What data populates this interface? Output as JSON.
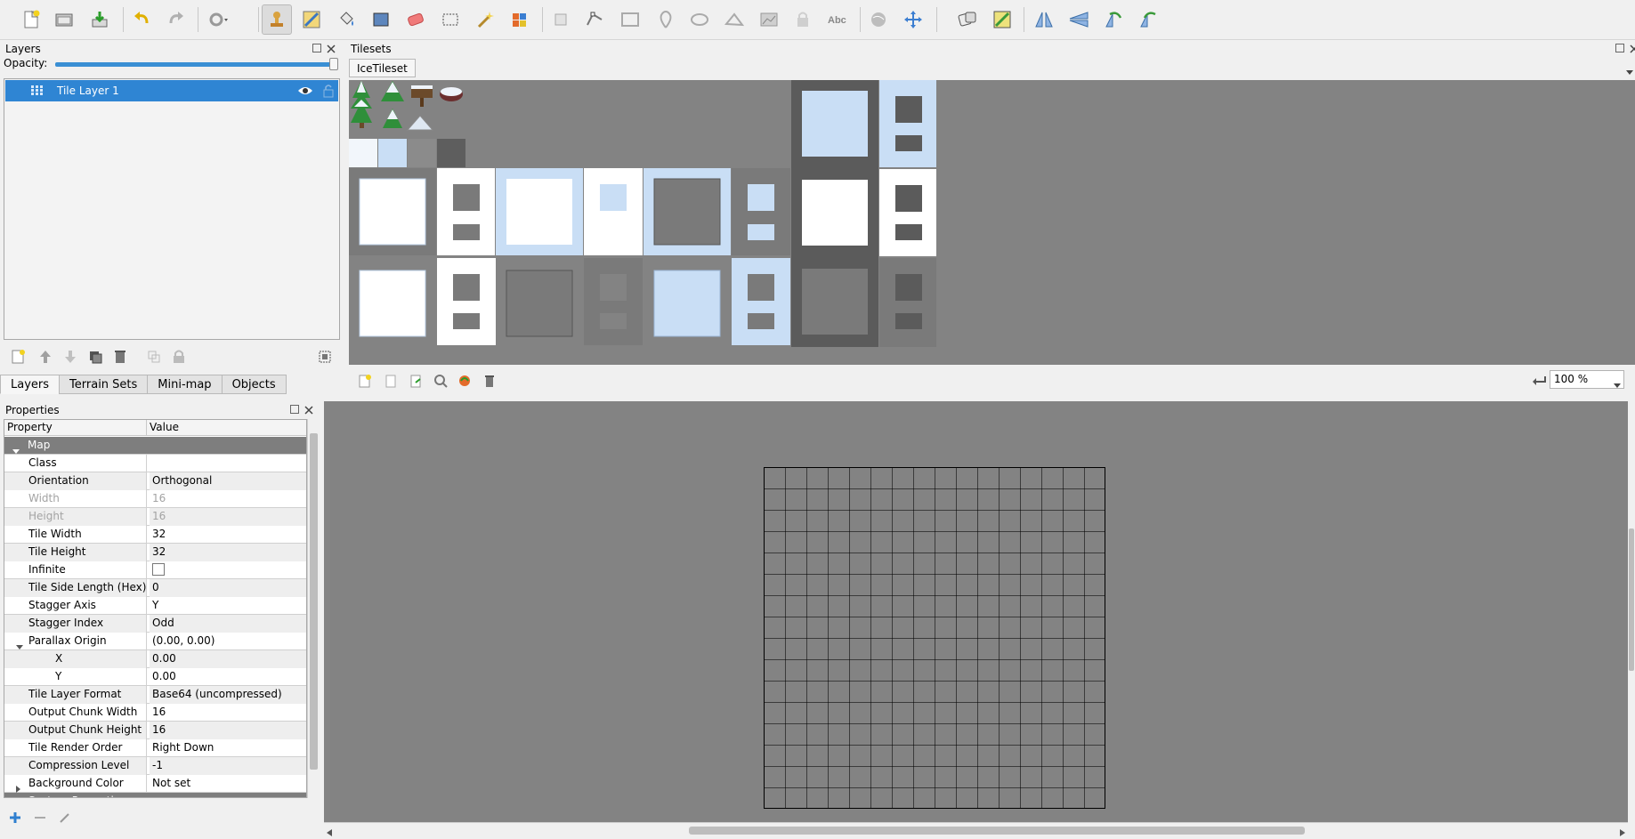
{
  "toolbar": {
    "icons": [
      "new-map-icon",
      "open-icon",
      "save-icon",
      "undo-icon",
      "redo-icon",
      "commands-icon",
      "stamp-brush-icon",
      "terrain-brush-icon",
      "bucket-fill-icon",
      "shape-fill-icon",
      "eraser-icon",
      "rect-select-icon",
      "magic-wand-icon",
      "select-same-tile-icon",
      "select-objects-icon",
      "edit-polygons-icon",
      "insert-rectangle-icon",
      "insert-point-icon",
      "insert-ellipse-icon",
      "insert-polygon-icon",
      "insert-tile-icon",
      "insert-template-icon",
      "insert-text-icon",
      "world-tool-icon",
      "move-icon",
      "random-mode-icon",
      "wang-fill-icon",
      "flip-horizontal-icon",
      "flip-vertical-icon",
      "rotate-left-icon",
      "rotate-right-icon"
    ]
  },
  "layers": {
    "title": "Layers",
    "opacity_label": "Opacity:",
    "opacity": 1.0,
    "items": [
      {
        "name": "Tile Layer 1",
        "visible": true
      }
    ]
  },
  "dock_tabs": [
    "Layers",
    "Terrain Sets",
    "Mini-map",
    "Objects"
  ],
  "properties": {
    "title": "Properties",
    "header": {
      "property": "Property",
      "value": "Value"
    },
    "rows": [
      {
        "name": "Map",
        "value": "",
        "kind": "group"
      },
      {
        "name": "Class",
        "value": ""
      },
      {
        "name": "Orientation",
        "value": "Orthogonal"
      },
      {
        "name": "Width",
        "value": "16",
        "kind": "dim"
      },
      {
        "name": "Height",
        "value": "16",
        "kind": "dim"
      },
      {
        "name": "Tile Width",
        "value": "32"
      },
      {
        "name": "Tile Height",
        "value": "32"
      },
      {
        "name": "Infinite",
        "value": "",
        "kind": "checkbox"
      },
      {
        "name": "Tile Side Length (Hex)",
        "value": "0"
      },
      {
        "name": "Stagger Axis",
        "value": "Y"
      },
      {
        "name": "Stagger Index",
        "value": "Odd"
      },
      {
        "name": "Parallax Origin",
        "value": "(0.00, 0.00)",
        "kind": "expanded"
      },
      {
        "name": "X",
        "value": "0.00",
        "kind": "sub"
      },
      {
        "name": "Y",
        "value": "0.00",
        "kind": "sub"
      },
      {
        "name": "Tile Layer Format",
        "value": "Base64 (uncompressed)"
      },
      {
        "name": "Output Chunk Width",
        "value": "16"
      },
      {
        "name": "Output Chunk Height",
        "value": "16"
      },
      {
        "name": "Tile Render Order",
        "value": "Right Down"
      },
      {
        "name": "Compression Level",
        "value": "-1"
      },
      {
        "name": "Background Color",
        "value": "Not set",
        "kind": "collapsed"
      },
      {
        "name": "Custom Properties",
        "value": "",
        "kind": "group"
      }
    ]
  },
  "tilesets": {
    "title": "Tilesets",
    "tabs": [
      "IceTileset"
    ]
  },
  "zoom": "100 %",
  "colors": {
    "accent": "#2f85d3",
    "canvas": "#838383",
    "group_row": "#7e7e7e"
  }
}
